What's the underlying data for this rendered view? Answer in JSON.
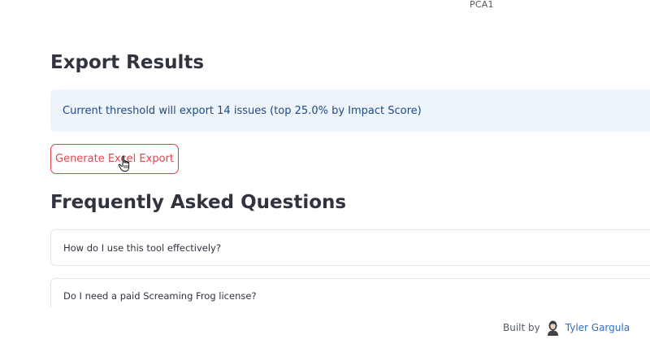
{
  "chart": {
    "axis_label": "PCA1"
  },
  "export": {
    "title": "Export Results",
    "info_text": "Current threshold will export 14 issues (top 25.0% by Impact Score)",
    "button_label": "Generate Excel Export"
  },
  "faq": {
    "title": "Frequently Asked Questions",
    "items": [
      {
        "question": "How do I use this tool effectively?"
      },
      {
        "question": "Do I need a paid Screaming Frog license?"
      }
    ]
  },
  "footer": {
    "built_by": "Built by",
    "author": "Tyler Gargula"
  },
  "colors": {
    "accent": "#e3444b",
    "info_background": "#eef4fc",
    "info_text": "#1f4a85",
    "link": "#2f6ec5"
  },
  "icons": {
    "cursor": "hand-pointer-icon",
    "avatar": "avatar"
  }
}
